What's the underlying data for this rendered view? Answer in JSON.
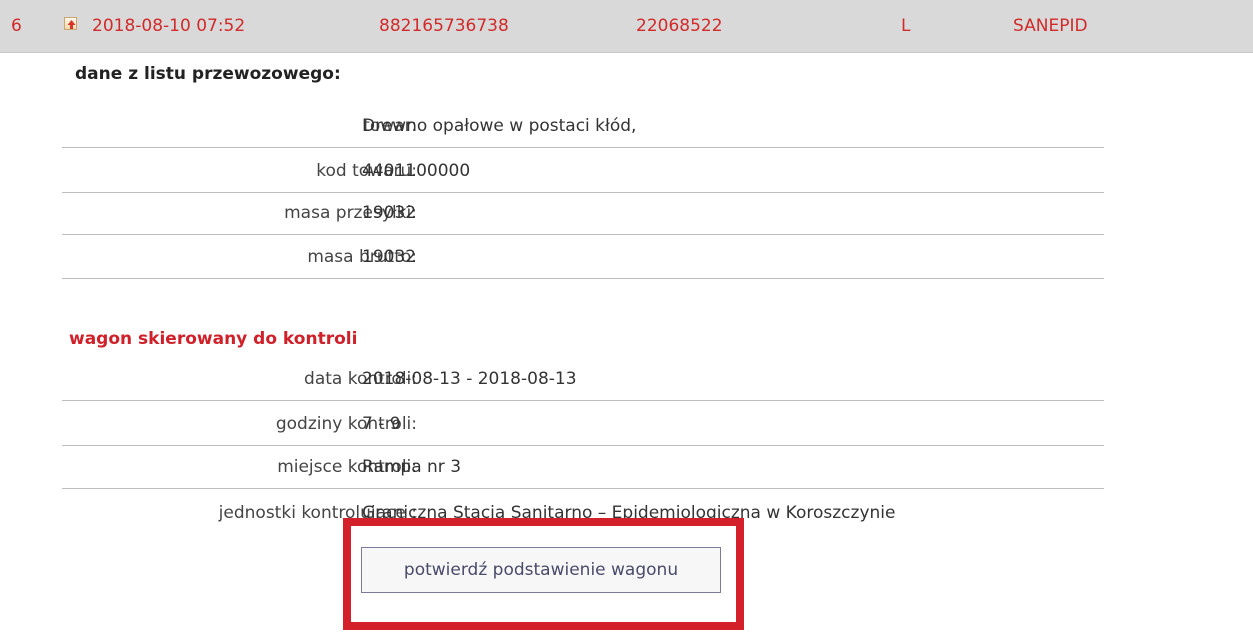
{
  "header": {
    "index": "6",
    "datetime": "2018-08-10 07:52",
    "wagon_number": "882165736738",
    "document_number": "22068522",
    "type": "L",
    "service": "SANEPID",
    "status_icon": "arrow-up-icon",
    "text_color": "#d22a2a",
    "background_color": "#d9d9d9"
  },
  "cargo": {
    "heading": "dane z listu przewozowego:",
    "rows": [
      {
        "label": "towar:",
        "value": "Drewno opałowe w postaci kłód,"
      },
      {
        "label": "kod towaru:",
        "value": "4401100000"
      },
      {
        "label": "masa przesyłki:",
        "value": "19032"
      },
      {
        "label": "masa brutto:",
        "value": "19032"
      }
    ]
  },
  "control": {
    "heading": "wagon skierowany do kontroli",
    "heading_color": "#d0202a",
    "rows": [
      {
        "label": "data kontroli:",
        "value": "2018-08-13 - 2018-08-13"
      },
      {
        "label": "godziny kontroli:",
        "value": "7 - 9"
      },
      {
        "label": "miejsce kontroli:",
        "value": "Rampa nr 3"
      },
      {
        "label": "jednostki kontrolujące :",
        "value": "Graniczna Stacja Sanitarno – Epidemiologiczna w Koroszczynie"
      }
    ],
    "confirm_button": "potwierdź podstawienie wagonu",
    "highlight_color": "#d4202a"
  }
}
